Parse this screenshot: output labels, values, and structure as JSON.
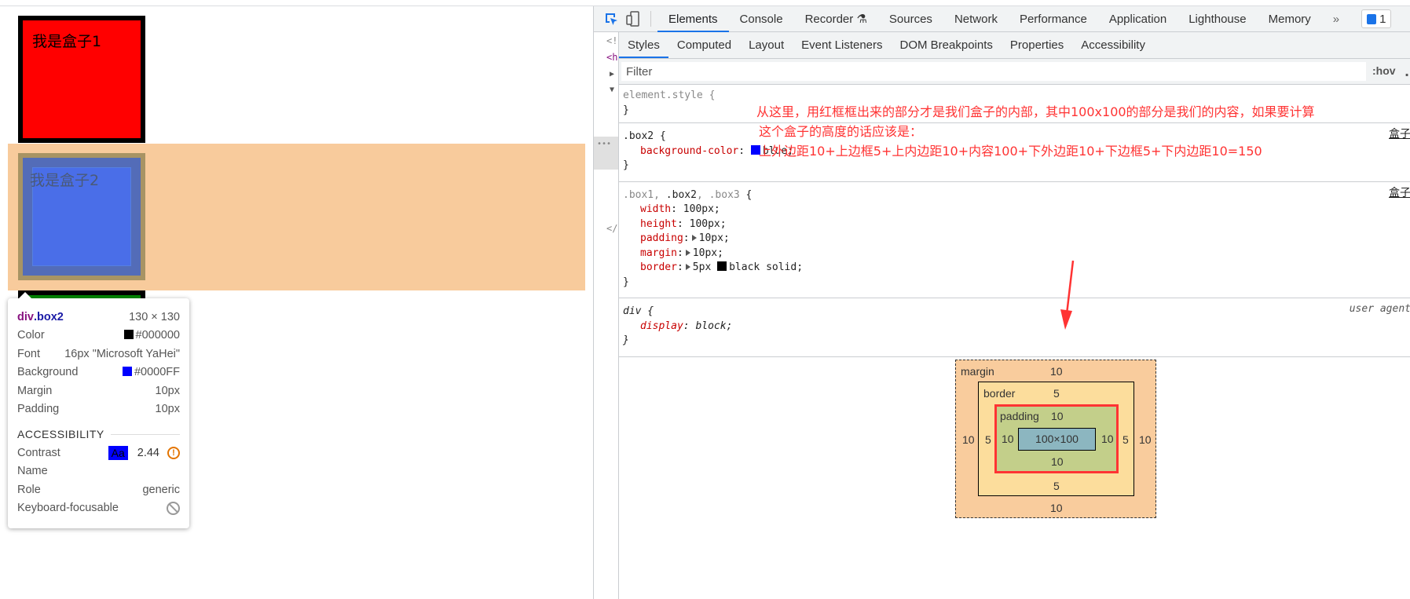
{
  "page": {
    "box1_text": "我是盒子1",
    "box2_text": "我是盒子2",
    "colors": {
      "box1": "#FF0000",
      "box2": "#0000FF",
      "box3": "#008000",
      "margin_highlight": "#F8CB9C"
    }
  },
  "tooltip": {
    "element": "div",
    "class": ".box2",
    "size": "130 × 130",
    "rows": [
      {
        "label": "Color",
        "value": "#000000",
        "swatch": "#000000"
      },
      {
        "label": "Font",
        "value": "16px \"Microsoft YaHei\""
      },
      {
        "label": "Background",
        "value": "#0000FF",
        "swatch": "#0000FF"
      },
      {
        "label": "Margin",
        "value": "10px"
      },
      {
        "label": "Padding",
        "value": "10px"
      }
    ],
    "accessibility_heading": "ACCESSIBILITY",
    "contrast_label": "Contrast",
    "contrast_sample": "Aa",
    "contrast_value": "2.44",
    "name_label": "Name",
    "role_label": "Role",
    "role_value": "generic",
    "keyboard_label": "Keyboard-focusable"
  },
  "devtools": {
    "tabs": [
      "Elements",
      "Console",
      "Recorder",
      "Sources",
      "Network",
      "Performance",
      "Application",
      "Lighthouse",
      "Memory"
    ],
    "active_tab": "Elements",
    "more": "»",
    "issues_count": "1",
    "subtabs": [
      "Styles",
      "Computed",
      "Layout",
      "Event Listeners",
      "DOM Breakpoints",
      "Properties",
      "Accessibility"
    ],
    "active_subtab": "Styles",
    "filter_placeholder": "Filter",
    "hov": ":hov",
    "cls": ".",
    "gutter": [
      "<!",
      "<h",
      "</"
    ],
    "rules": {
      "element_style": "element.style {",
      "close": "}",
      "box2_selector": ".box2 {",
      "box2_prop": "background-color",
      "box2_value": "blue;",
      "box2_source": "盒子",
      "group_selector_dim1": ".box1, ",
      "group_selector_active": ".box2",
      "group_selector_dim2": ", .box3",
      "group_open": " {",
      "group_source": "盒子",
      "group_props": [
        {
          "name": "width",
          "value": "100px;"
        },
        {
          "name": "height",
          "value": "100px;"
        },
        {
          "name": "padding",
          "value": "10px;",
          "expand": true
        },
        {
          "name": "margin",
          "value": "10px;",
          "expand": true
        },
        {
          "name": "border",
          "value": "5px",
          "expand": true,
          "swatch": "#000000",
          "value2": "black solid;"
        }
      ],
      "div_selector": "div {",
      "div_prop": "display",
      "div_value": "block;",
      "div_source": "user agent"
    },
    "annotation": [
      "从这里，用红框框出来的部分才是我们盒子的内部，其中100x100的部分是我们的内容，如果要计算",
      "这个盒子的高度的话应该是：",
      "上外边距10+上边框5+上内边距10+内容100+下外边距10+下边框5+下内边距10=150"
    ],
    "annotation_color": "#FF3333",
    "box_model": {
      "margin_label": "margin",
      "margin": {
        "top": "10",
        "right": "10",
        "bottom": "10",
        "left": "10"
      },
      "border_label": "border",
      "border": {
        "top": "5",
        "right": "5",
        "bottom": "5",
        "left": "5"
      },
      "padding_label": "padding",
      "padding": {
        "top": "10",
        "right": "10",
        "bottom": "10",
        "left": "10"
      },
      "content": "100×100"
    }
  }
}
